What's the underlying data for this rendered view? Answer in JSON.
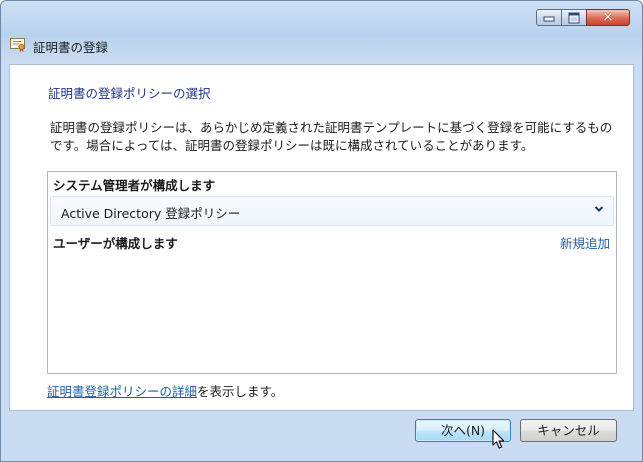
{
  "window": {
    "title": "証明書の登録",
    "controls": {
      "minimize": "minimize",
      "maximize": "maximize",
      "close": "✕"
    }
  },
  "page": {
    "heading": "証明書の登録ポリシーの選択",
    "description": "証明書の登録ポリシーは、あらかじめ定義された証明書テンプレートに基づく登録を可能にするものです。場合によっては、証明書の登録ポリシーは既に構成されていることがあります。"
  },
  "list": {
    "admin_group_label": "システム管理者が構成します",
    "policies": [
      {
        "name": "Active Directory 登録ポリシー",
        "expanded": false
      }
    ],
    "user_group_label": "ユーザーが構成します",
    "add_new_label": "新規追加"
  },
  "details": {
    "link_text": "証明書登録ポリシーの詳細",
    "suffix": "を表示します。"
  },
  "buttons": {
    "next": "次へ(N)",
    "cancel": "キャンセル"
  },
  "colors": {
    "link": "#1f5fa8",
    "heading": "#1e3287",
    "frame": "#b9d2ee"
  },
  "icons": {
    "title": "certificate-icon",
    "policy_toggle": "chevron-down-icon",
    "pointer": "mouse-cursor-icon"
  }
}
